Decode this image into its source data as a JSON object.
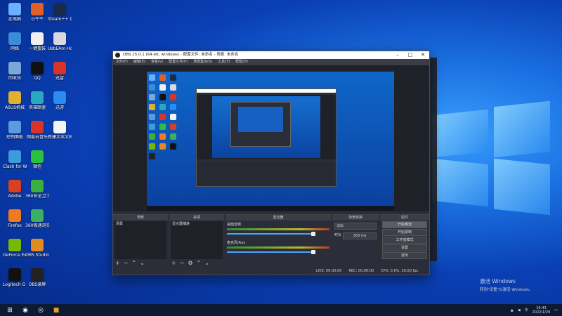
{
  "desktop_icons": [
    {
      "label": "此电脑",
      "color": "#6ab0ff"
    },
    {
      "label": "小牛牛",
      "color": "#e0602a"
    },
    {
      "label": "Steam++ 加速",
      "color": "#1a2a4a"
    },
    {
      "label": "网络",
      "color": "#3a8cd8"
    },
    {
      "label": "一键重装",
      "color": "#f0f0f0"
    },
    {
      "label": "UsbEAm Hosts Editor",
      "color": "#d8d8e0"
    },
    {
      "label": "回收站",
      "color": "#7aa8d8"
    },
    {
      "label": "QQ",
      "color": "#111"
    },
    {
      "label": "迅雷",
      "color": "#d8342a"
    },
    {
      "label": "ASUS机械",
      "color": "#e0b030"
    },
    {
      "label": "英雄联盟",
      "color": "#2aa8c0"
    },
    {
      "label": "迅游",
      "color": "#2a8cf0"
    },
    {
      "label": "控制面板",
      "color": "#5a9ae0"
    },
    {
      "label": "网易云音乐",
      "color": "#d8342a"
    },
    {
      "label": "新建文本文档",
      "color": "#f4f4f4"
    },
    {
      "label": "Clash for Windows",
      "color": "#3a9cd8"
    },
    {
      "label": "微信",
      "color": "#2ac040"
    },
    {
      "label": "",
      "color": "transparent"
    },
    {
      "label": "Adobe",
      "color": "#d84020"
    },
    {
      "label": "360安全卫士",
      "color": "#3ab040"
    },
    {
      "label": "",
      "color": "transparent"
    },
    {
      "label": "Firefox",
      "color": "#f07a20"
    },
    {
      "label": "360极速浏览器",
      "color": "#3ab060"
    },
    {
      "label": "",
      "color": "transparent"
    },
    {
      "label": "GeForce Experience",
      "color": "#76b900"
    },
    {
      "label": "OBS Studio",
      "color": "#e08a20"
    },
    {
      "label": "",
      "color": "transparent"
    },
    {
      "label": "Logitech G HUB",
      "color": "#111"
    },
    {
      "label": "OBS录屏",
      "color": "#222"
    },
    {
      "label": "",
      "color": "transparent"
    }
  ],
  "obs": {
    "title": "OBS 25.0.1 (64-bit, windows) - 配置文件: 未命名 - 场景: 未命名",
    "menu": [
      "文件(F)",
      "编辑(E)",
      "查看(V)",
      "配置文件(P)",
      "场景集合(S)",
      "工具(T)",
      "帮助(H)"
    ],
    "docks": {
      "scenes": {
        "title": "场景",
        "items": [
          "场景"
        ]
      },
      "sources": {
        "title": "来源",
        "items": [
          "显示器捕获"
        ]
      },
      "mixer": {
        "title": "混音器",
        "tracks": [
          {
            "name": "桌面音频",
            "db": "0.0 dB"
          },
          {
            "name": "麦克风/Aux",
            "db": "0.0 dB"
          }
        ]
      },
      "transitions": {
        "title": "场景转换",
        "type": "淡出",
        "duration_label": "时长",
        "duration": "300 ms"
      },
      "controls": {
        "title": "控件",
        "buttons": [
          "开始推流",
          "开始录制",
          "工作室模式",
          "设置",
          "退出"
        ]
      }
    },
    "status": {
      "live": "LIVE: 00:00:00",
      "rec": "REC: 00:00:00",
      "cpu": "CPU: 0.6%, 30.00 fps"
    }
  },
  "taskbar": {
    "time": "16:43",
    "date": "2022/1/29",
    "lang": "中"
  },
  "watermark": {
    "line1": "激活 Windows",
    "line2": "转到\"设置\"以激活 Windows。"
  }
}
